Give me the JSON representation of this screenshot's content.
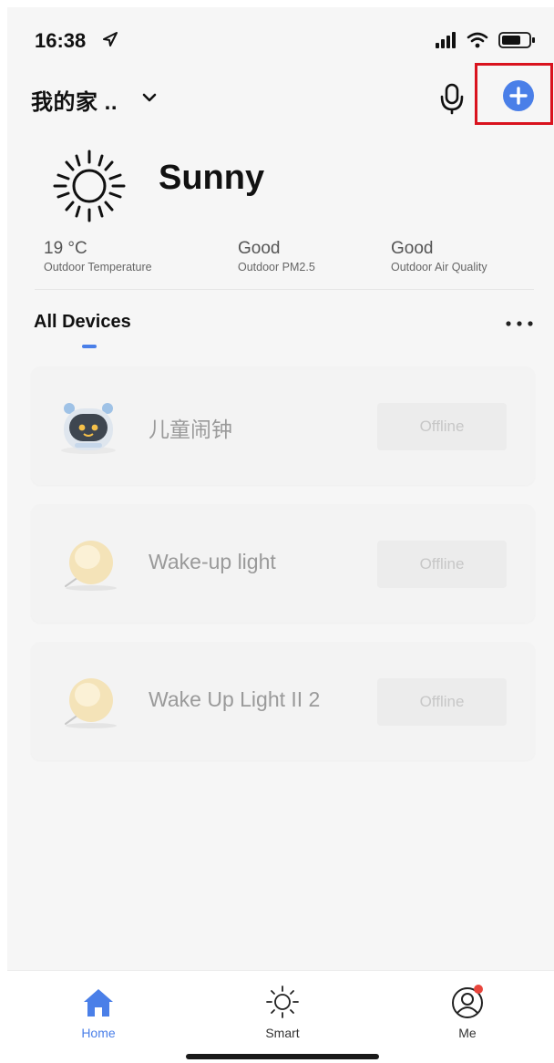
{
  "status_bar": {
    "time": "16:38"
  },
  "header": {
    "home_title": "我的家 .."
  },
  "weather": {
    "condition": "Sunny",
    "stats": [
      {
        "value": "19 °C",
        "label": "Outdoor Temperature"
      },
      {
        "value": "Good",
        "label": "Outdoor PM2.5"
      },
      {
        "value": "Good",
        "label": "Outdoor Air Quality"
      }
    ]
  },
  "devices_section": {
    "title": "All Devices",
    "devices": [
      {
        "name": "儿童闹钟",
        "status": "Offline",
        "icon": "alarm-clock-device"
      },
      {
        "name": "Wake-up light",
        "status": "Offline",
        "icon": "wake-up-light-device"
      },
      {
        "name": "Wake Up Light II 2",
        "status": "Offline",
        "icon": "wake-up-light-device"
      }
    ]
  },
  "tabbar": {
    "tabs": [
      {
        "label": "Home",
        "icon": "home-icon",
        "active": true
      },
      {
        "label": "Smart",
        "icon": "sun-icon",
        "active": false
      },
      {
        "label": "Me",
        "icon": "user-icon",
        "active": false,
        "badge": true
      }
    ]
  },
  "colors": {
    "accent": "#4a7fe8",
    "highlight_frame": "#d9131e",
    "badge": "#e8453c",
    "background": "#f6f6f6"
  }
}
